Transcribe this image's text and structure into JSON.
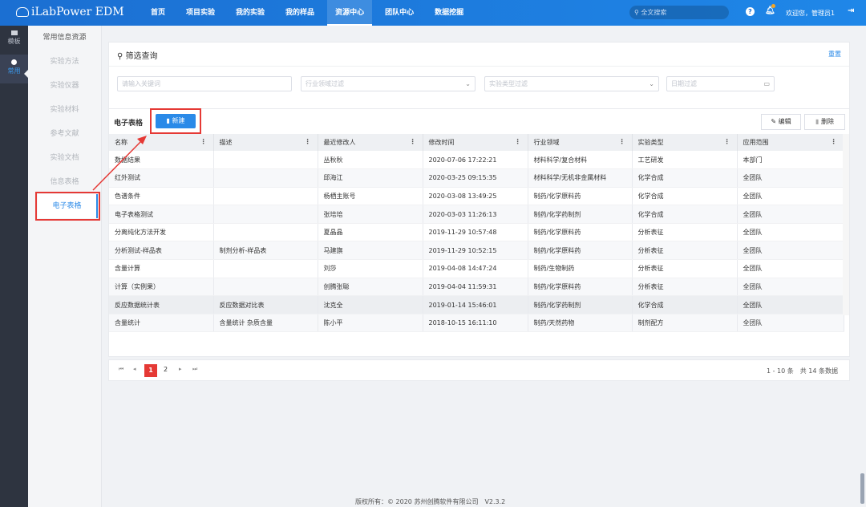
{
  "app": {
    "logo": "iLabPower EDM"
  },
  "nav": [
    "首页",
    "项目实验",
    "我的实验",
    "我的样品",
    "资源中心",
    "团队中心",
    "数据挖掘"
  ],
  "header": {
    "search_placeholder": "全文搜索",
    "welcome": "欢迎您，管理员1"
  },
  "rail": [
    {
      "label": "模板"
    },
    {
      "label": "常用"
    }
  ],
  "sidenav": {
    "title": "常用信息资源",
    "items": [
      "实验方法",
      "实验仪器",
      "实验材料",
      "参考文献",
      "实验文档",
      "信息表格",
      "电子表格"
    ]
  },
  "filter": {
    "title": "筛选查询",
    "reset": "重置",
    "keyword_placeholder": "请输入关键词",
    "industry_placeholder": "行业领域过滤",
    "type_placeholder": "实验类型过滤",
    "date_placeholder": "日期过滤"
  },
  "table": {
    "title": "电子表格",
    "new_label": "新建",
    "edit_label": "编辑",
    "delete_label": "删除",
    "columns": [
      "名称",
      "描述",
      "最近修改人",
      "修改时间",
      "行业领域",
      "实验类型",
      "应用范围"
    ],
    "rows": [
      [
        "数据结果",
        "",
        "丛秋秋",
        "2020-07-06 17:22:21",
        "材料科学/复合材料",
        "工艺研发",
        "本部门"
      ],
      [
        "红外测试",
        "",
        "邱海江",
        "2020-03-25 09:15:35",
        "材料科学/无机非金属材料",
        "化学合成",
        "全团队"
      ],
      [
        "色谱条件",
        "",
        "杨栖主账号",
        "2020-03-08 13:49:25",
        "制药/化学原料药",
        "化学合成",
        "全团队"
      ],
      [
        "电子表格测试",
        "",
        "张培培",
        "2020-03-03 11:26:13",
        "制药/化学药制剂",
        "化学合成",
        "全团队"
      ],
      [
        "分离纯化方法开发",
        "",
        "夏晶晶",
        "2019-11-29 10:57:48",
        "制药/化学原料药",
        "分析表征",
        "全团队"
      ],
      [
        "分析测试-样品表",
        "制剂分析-样品表",
        "马建旗",
        "2019-11-29 10:52:15",
        "制药/化学原料药",
        "分析表征",
        "全团队"
      ],
      [
        "含量计算",
        "",
        "刘莎",
        "2019-04-08 14:47:24",
        "制药/生物制药",
        "分析表征",
        "全团队"
      ],
      [
        "计算（实例果）",
        "",
        "创腾张聪",
        "2019-04-04 11:59:31",
        "制药/化学原料药",
        "分析表征",
        "全团队"
      ],
      [
        "反应数据统计表",
        "反应数据对比表",
        "沈克全",
        "2019-01-14 15:46:01",
        "制药/化学药制剂",
        "化学合成",
        "全团队"
      ],
      [
        "含量统计",
        "含量统计 杂质含量",
        "陈小平",
        "2018-10-15 16:11:10",
        "制药/天然药物",
        "制剂配方",
        "全团队"
      ]
    ]
  },
  "pagination": {
    "pages": [
      "1",
      "2"
    ],
    "current": "1",
    "info": "1 - 10 条　共 14 条数据"
  },
  "footer": "版权所有：© 2020 苏州创腾软件有限公司　V2.3.2"
}
